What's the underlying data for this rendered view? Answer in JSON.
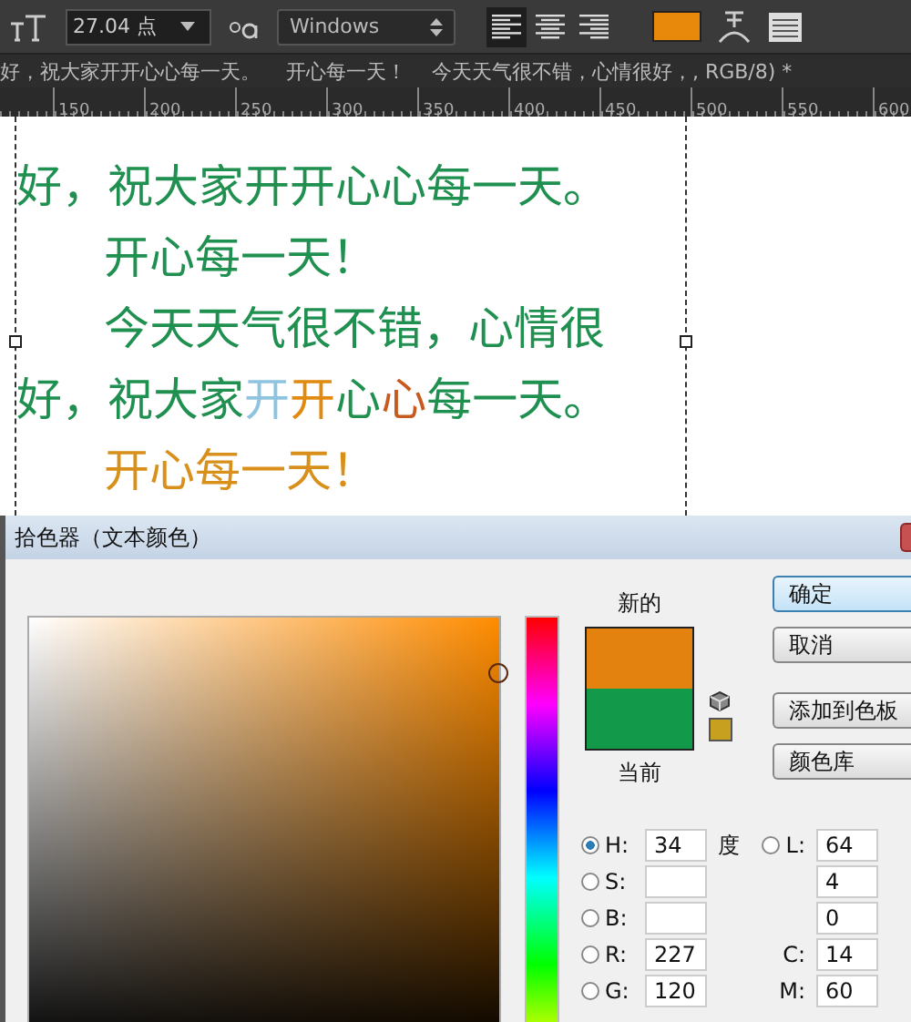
{
  "toolbar": {
    "font_size": "27.04 点",
    "antialias": "Windows",
    "align": [
      {
        "kind": "left",
        "selected": true
      },
      {
        "kind": "center",
        "selected": false
      },
      {
        "kind": "right",
        "selected": false
      }
    ]
  },
  "document_tab": {
    "title": "好，祝大家开开心心每一天。    开心每一天！    今天天气很不错，心情很好，, RGB/8) *"
  },
  "ruler": {
    "ticks": [
      "150",
      "200",
      "250",
      "300",
      "350",
      "400",
      "450",
      "500",
      "550",
      "600"
    ]
  },
  "canvas_text": [
    {
      "indent": false,
      "runs": [
        {
          "text": "好，祝大家开开心心每一天。",
          "color": "#1f9050"
        }
      ]
    },
    {
      "indent": true,
      "runs": [
        {
          "text": "开心每一天！",
          "color": "#1f9050"
        }
      ]
    },
    {
      "indent": true,
      "runs": [
        {
          "text": "今天天气很不错，心情很",
          "color": "#1f9050"
        }
      ]
    },
    {
      "indent": false,
      "runs": [
        {
          "text": "好，祝大家",
          "color": "#1f9050"
        },
        {
          "text": "开",
          "color": "#8fc4e0"
        },
        {
          "text": "开",
          "color": "#e08a10"
        },
        {
          "text": "心",
          "color": "#1f9050"
        },
        {
          "text": "心",
          "color": "#c85a20"
        },
        {
          "text": "每一天。",
          "color": "#1f9050"
        }
      ]
    },
    {
      "indent": true,
      "runs": [
        {
          "text": "开心每一天！",
          "color": "#d9901a"
        }
      ]
    }
  ],
  "dialog": {
    "title": "拾色器（文本颜色）",
    "new_label": "新的",
    "current_label": "当前",
    "buttons": [
      {
        "label": "确定",
        "default": true
      },
      {
        "label": "取消",
        "default": false
      },
      {
        "label": "添加到色板",
        "default": false
      },
      {
        "label": "颜色库",
        "default": false
      }
    ],
    "left_fields": [
      {
        "label": "H:",
        "value": "34",
        "unit": "度",
        "selected": true
      },
      {
        "label": "S:",
        "selected": false
      },
      {
        "label": "B:",
        "selected": false
      },
      {
        "label": "R:",
        "value": "227",
        "selected": false
      },
      {
        "label": "G:",
        "value": "120",
        "selected": false
      }
    ],
    "right_fields": [
      {
        "kind": "radio",
        "label": "L:",
        "value": "64",
        "selected": false
      },
      {
        "kind": "plain",
        "value": "4"
      },
      {
        "kind": "plain",
        "value": "0"
      },
      {
        "kind": "plain",
        "label": "C:",
        "value": "14"
      },
      {
        "kind": "plain",
        "label": "M:",
        "value": "60"
      }
    ]
  }
}
